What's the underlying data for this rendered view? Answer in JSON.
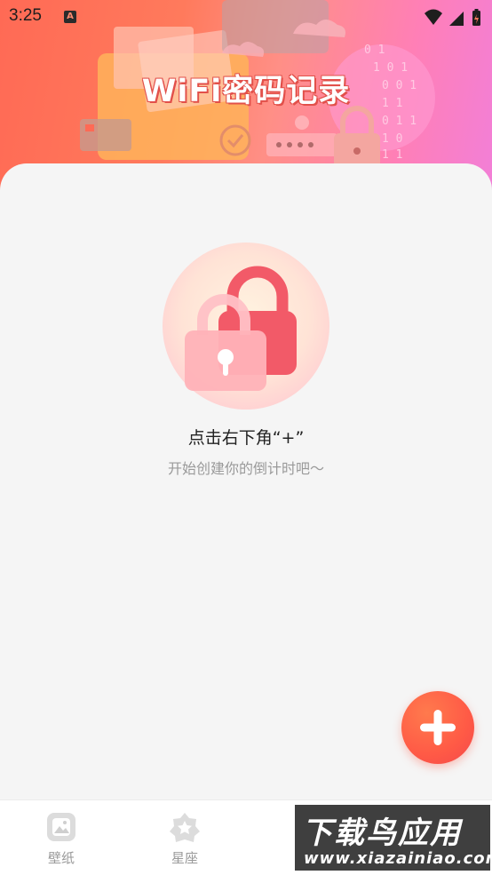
{
  "status_bar": {
    "time": "3:25",
    "notification_icon": "A"
  },
  "header": {
    "title": "WiFi密码记录"
  },
  "empty_state": {
    "title": "点击右下角“+”",
    "subtitle": "开始创建你的倒计时吧～"
  },
  "fab": {
    "icon": "plus-icon"
  },
  "bottom_nav": {
    "items": [
      {
        "label": "壁纸",
        "icon": "wallpaper-icon"
      },
      {
        "label": "星座",
        "icon": "star-icon"
      }
    ]
  },
  "watermark": {
    "line1": "下载鸟应用",
    "line2": "www.xiazainiao.com"
  },
  "colors": {
    "accent": "#ff5a46",
    "banner_start": "#ff6a55",
    "banner_end": "#f27fd8"
  }
}
